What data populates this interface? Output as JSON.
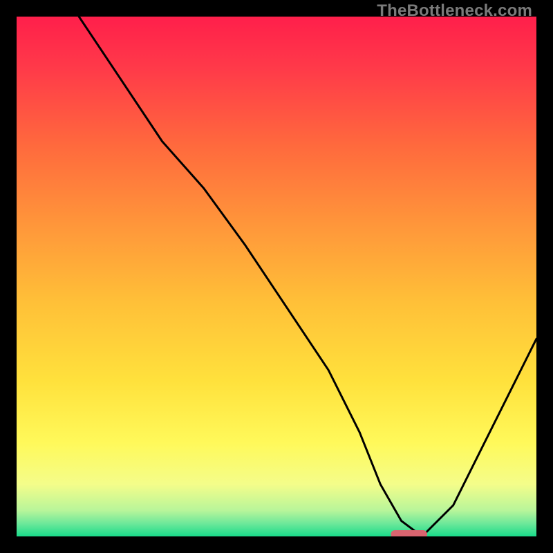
{
  "watermark": "TheBottleneck.com",
  "chart_data": {
    "type": "line",
    "title": "",
    "xlabel": "",
    "ylabel": "",
    "xlim": [
      0,
      100
    ],
    "ylim": [
      0,
      100
    ],
    "grid": false,
    "legend": false,
    "series": [
      {
        "name": "bottleneck-curve",
        "x": [
          12,
          20,
          28,
          36,
          44,
          52,
          60,
          66,
          70,
          74,
          78,
          84,
          90,
          96,
          100
        ],
        "y": [
          100,
          88,
          76,
          67,
          56,
          44,
          32,
          20,
          10,
          3,
          0,
          6,
          18,
          30,
          38
        ]
      }
    ],
    "marker": {
      "name": "optimal-zone",
      "x_start": 72,
      "x_end": 79,
      "y": 0,
      "color": "#d9646f"
    },
    "background_gradient": {
      "stops": [
        {
          "offset": 0.0,
          "color": "#ff1f4b"
        },
        {
          "offset": 0.1,
          "color": "#ff3a49"
        },
        {
          "offset": 0.25,
          "color": "#ff6a3d"
        },
        {
          "offset": 0.4,
          "color": "#ff963a"
        },
        {
          "offset": 0.55,
          "color": "#ffc038"
        },
        {
          "offset": 0.7,
          "color": "#ffe13c"
        },
        {
          "offset": 0.82,
          "color": "#fff95a"
        },
        {
          "offset": 0.9,
          "color": "#f4fd8a"
        },
        {
          "offset": 0.95,
          "color": "#b8f59a"
        },
        {
          "offset": 0.975,
          "color": "#6ee89a"
        },
        {
          "offset": 1.0,
          "color": "#19db8a"
        }
      ]
    }
  }
}
